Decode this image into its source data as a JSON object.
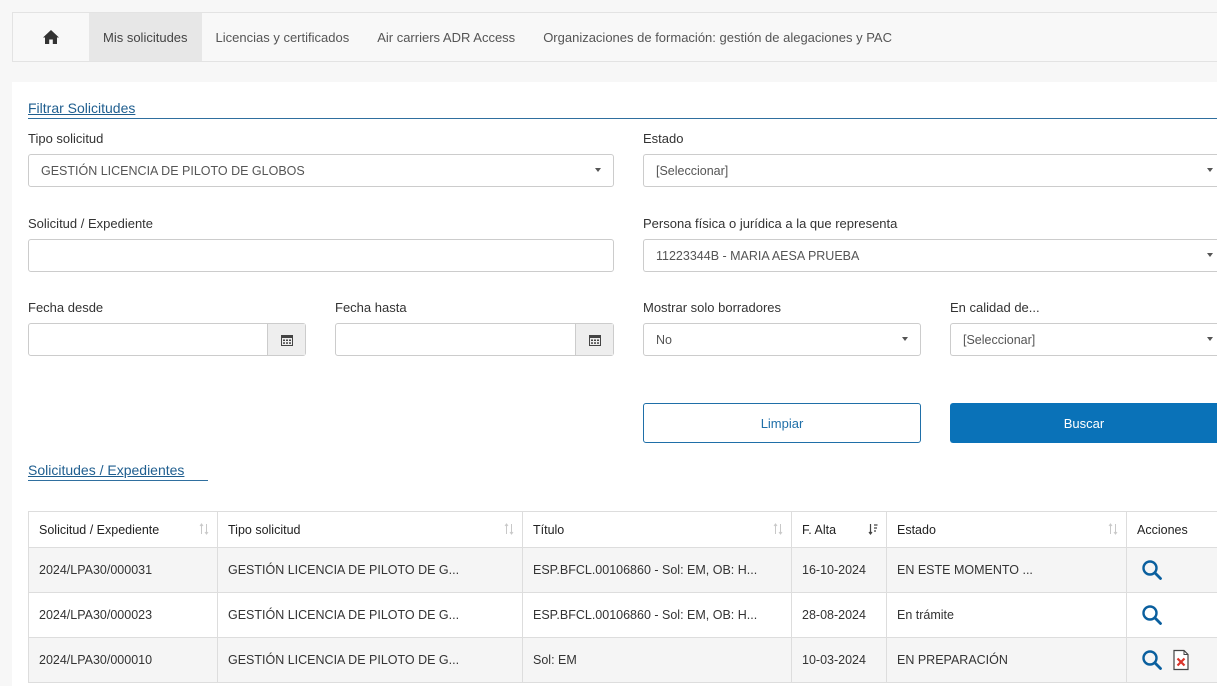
{
  "nav": {
    "items": [
      {
        "label": "Mis solicitudes",
        "active": true
      },
      {
        "label": "Licencias y certificados",
        "active": false
      },
      {
        "label": "Air carriers ADR Access",
        "active": false
      },
      {
        "label": "Organizaciones de formación: gestión de alegaciones y PAC",
        "active": false
      }
    ]
  },
  "filter": {
    "title": "Filtrar Solicitudes",
    "tipo_label": "Tipo solicitud",
    "tipo_value": "GESTIÓN LICENCIA DE PILOTO DE GLOBOS",
    "estado_label": "Estado",
    "estado_value": "[Seleccionar]",
    "solicitud_label": "Solicitud / Expediente",
    "solicitud_value": "",
    "persona_label": "Persona física o jurídica a la que representa",
    "persona_value": "11223344B - MARIA AESA PRUEBA",
    "fecha_desde_label": "Fecha desde",
    "fecha_hasta_label": "Fecha hasta",
    "borradores_label": "Mostrar solo borradores",
    "borradores_value": "No",
    "calidad_label": "En calidad de...",
    "calidad_value": "[Seleccionar]",
    "clear_label": "Limpiar",
    "search_label": "Buscar"
  },
  "results": {
    "title": "Solicitudes / Expedientes",
    "columns": [
      "Solicitud / Expediente",
      "Tipo solicitud",
      "Título",
      "F. Alta",
      "Estado",
      "Acciones"
    ],
    "rows": [
      [
        "2024/LPA30/000031",
        "GESTIÓN LICENCIA DE PILOTO DE G...",
        "ESP.BFCL.00106860 - Sol: EM, OB: H...",
        "16-10-2024",
        "EN ESTE MOMENTO ..."
      ],
      [
        "2024/LPA30/000023",
        "GESTIÓN LICENCIA DE PILOTO DE G...",
        "ESP.BFCL.00106860 - Sol: EM, OB: H...",
        "28-08-2024",
        "En trámite"
      ],
      [
        "2024/LPA30/000010",
        "GESTIÓN LICENCIA DE PILOTO DE G...",
        "Sol: EM",
        "10-03-2024",
        "EN PREPARACIÓN"
      ]
    ]
  },
  "icons": {
    "home": "home-icon",
    "calendar": "calendar-icon",
    "view": "magnifier-icon",
    "delete": "delete-document-icon",
    "sort": "sort-icon"
  },
  "colors": {
    "accent": "#0a72b8",
    "title": "#1f5e8f",
    "delete": "#d9342b"
  }
}
